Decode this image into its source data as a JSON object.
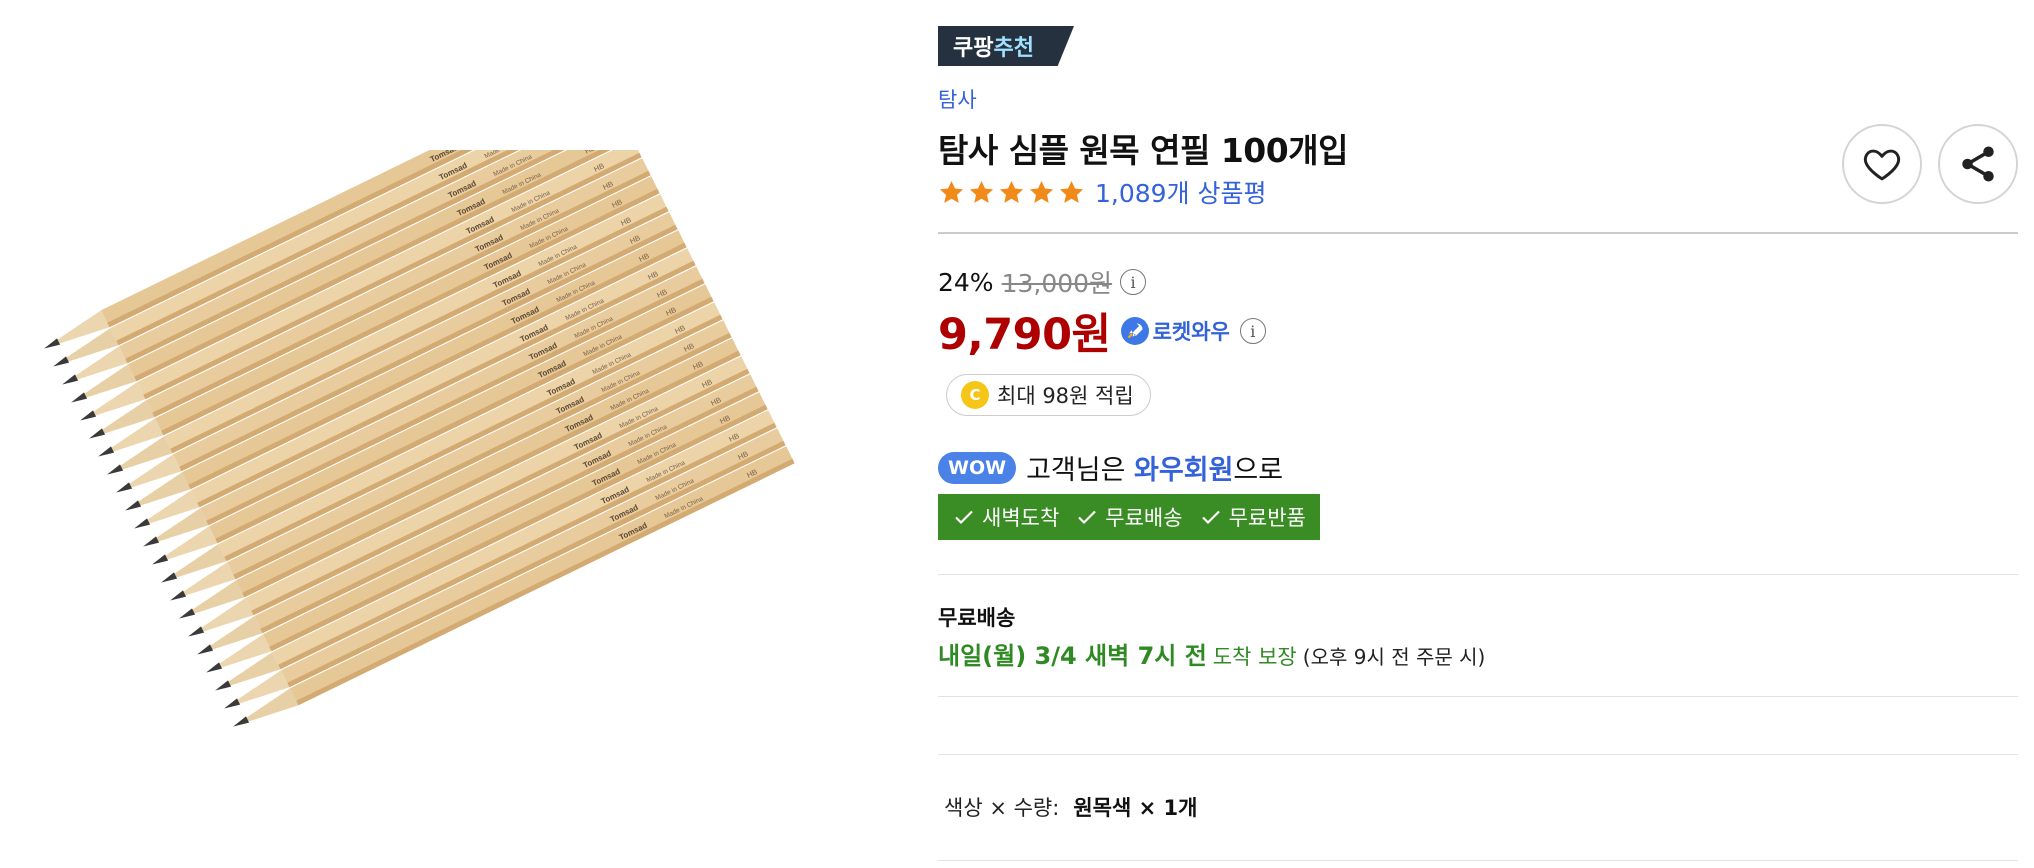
{
  "product_image": {
    "alt": "탐사 원목 연필 묶음 이미지",
    "pencil_brand": "Tomsad",
    "pencil_text": "Made in China",
    "pencil_grade": "HB"
  },
  "badge": {
    "part1": "쿠팡",
    "part2": "추천"
  },
  "brand": "탐사",
  "title": "탐사 심플 원목 연필 100개입",
  "rating": {
    "stars": 5,
    "review_count": "1,089개 상품평"
  },
  "actions": {
    "wishlist_icon": "heart-icon",
    "share_icon": "share-icon"
  },
  "price": {
    "discount": "24%",
    "original": "13,000원",
    "sale": "9,790원",
    "delivery_brand": "로켓와우",
    "info_glyph": "i"
  },
  "cashback": {
    "coin_glyph": "C",
    "text": "최대 98원 적립"
  },
  "wow": {
    "badge": "WOW",
    "prefix": "고객님은",
    "highlight": "와우회원",
    "suffix": "으로"
  },
  "benefits": [
    "새벽도착",
    "무료배송",
    "무료반품"
  ],
  "shipping": {
    "title": "무료배송",
    "date": "내일(월) 3/4 새벽 7시 전",
    "guarantee": "도착 보장",
    "note": "(오후 9시 전 주문 시)"
  },
  "option": {
    "label": "색상 × 수량:",
    "value": "원목색 × 1개"
  },
  "colors": {
    "accent_blue": "#3462d9",
    "sale_red": "#ae0000",
    "benefit_green": "#3a8c24",
    "star_orange": "#f28a1a",
    "badge_dark": "#25313e"
  }
}
